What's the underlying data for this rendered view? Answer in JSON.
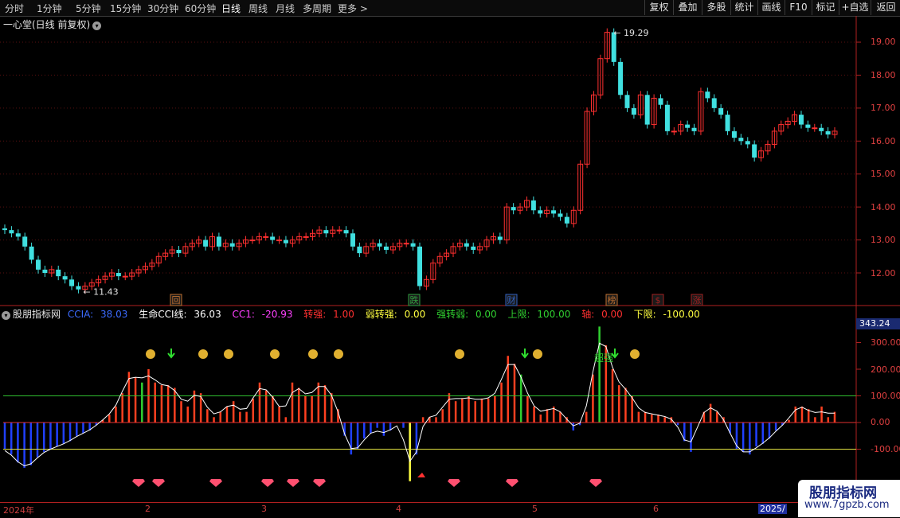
{
  "toolbar": {
    "timeframes": [
      "分时",
      "1分钟",
      "5分钟",
      "15分钟",
      "30分钟",
      "60分钟",
      "日线",
      "周线",
      "月线",
      "多周期",
      "更多 >"
    ],
    "active_timeframe": "日线",
    "buttons": [
      "复权",
      "叠加",
      "多股",
      "统计",
      "画线",
      "F10",
      "标记",
      "+自选",
      "返回"
    ]
  },
  "main_chart": {
    "title": "一心堂(日线 前复权)",
    "price_axis": [
      "19.00",
      "18.00",
      "17.00",
      "16.00",
      "15.00",
      "14.00",
      "13.00",
      "12.00"
    ],
    "high_label": "19.29",
    "low_label": "11.43",
    "event_markers": [
      "回",
      "跌",
      "财",
      "榜",
      "$",
      "涨"
    ]
  },
  "indicator": {
    "name": "股朋指标网",
    "fields": [
      {
        "label": "CCIA: ",
        "value": "38.03",
        "color": "#3b6bff"
      },
      {
        "label": "生命CCI线: ",
        "value": "36.03",
        "color": "#ffffff"
      },
      {
        "label": "CC1: ",
        "value": "-20.93",
        "color": "#ff40ff"
      },
      {
        "label": "转强: ",
        "value": "1.00",
        "color": "#ff3030"
      },
      {
        "label": "弱转强: ",
        "value": "0.00",
        "color": "#ffff40"
      },
      {
        "label": "强转弱: ",
        "value": "0.00",
        "color": "#30d030"
      },
      {
        "label": "上限: ",
        "value": "100.00",
        "color": "#30d030"
      },
      {
        "label": "轴: ",
        "value": "0.00",
        "color": "#ff3030"
      },
      {
        "label": "下限: ",
        "value": "-100.00",
        "color": "#ffff40"
      }
    ],
    "axis": [
      "300.00",
      "200.00",
      "100.00",
      "0.00",
      "-100.00"
    ],
    "current_value": "343.24",
    "chart_texts": [
      "超强"
    ]
  },
  "date_axis": {
    "year": "2024年",
    "months": [
      "2",
      "3",
      "4",
      "5",
      "6"
    ],
    "year_next": "2025/"
  },
  "watermark": {
    "title": "股朋指标网",
    "url": "www.7gpzb.com"
  },
  "chart_data": [
    {
      "type": "candlestick",
      "title": "一心堂(日线 前复权)",
      "y_axis": [
        11.6,
        19.6
      ],
      "close": [
        13.3,
        13.2,
        13.1,
        12.8,
        12.4,
        12.1,
        12.0,
        12.1,
        11.9,
        11.8,
        11.6,
        11.5,
        11.6,
        11.7,
        11.8,
        11.9,
        12.0,
        11.9,
        11.9,
        12.0,
        12.1,
        12.2,
        12.3,
        12.5,
        12.6,
        12.7,
        12.6,
        12.8,
        12.9,
        13.0,
        12.8,
        13.1,
        12.8,
        12.9,
        12.8,
        12.9,
        13.0,
        13.0,
        13.1,
        13.1,
        13.0,
        13.0,
        12.9,
        13.0,
        13.1,
        13.1,
        13.2,
        13.3,
        13.2,
        13.3,
        13.3,
        13.2,
        12.8,
        12.6,
        12.8,
        12.9,
        12.8,
        12.7,
        12.8,
        12.9,
        12.9,
        12.8,
        11.6,
        11.8,
        12.3,
        12.5,
        12.6,
        12.8,
        12.9,
        12.8,
        12.7,
        12.8,
        13.0,
        13.1,
        13.0,
        14.0,
        13.9,
        14.0,
        14.2,
        13.9,
        13.8,
        13.9,
        13.8,
        13.7,
        13.5,
        13.9,
        15.3,
        16.9,
        17.4,
        18.5,
        19.3,
        18.4,
        17.4,
        17.0,
        16.8,
        17.4,
        16.5,
        17.3,
        17.1,
        16.3,
        16.3,
        16.5,
        16.4,
        16.3,
        17.5,
        17.3,
        17.0,
        16.8,
        16.3,
        16.1,
        16.0,
        15.9,
        15.5,
        15.7,
        15.9,
        16.3,
        16.5,
        16.6,
        16.8,
        16.5,
        16.4,
        16.4,
        16.3,
        16.2,
        16.3
      ]
    },
    {
      "type": "bar",
      "title": "股朋指标网",
      "series_name": "CCIA",
      "y_axis": [
        -230,
        380
      ],
      "values": [
        -100,
        -120,
        -150,
        -170,
        -160,
        -130,
        -110,
        -100,
        -90,
        -80,
        -70,
        -50,
        -40,
        -30,
        -10,
        10,
        30,
        60,
        110,
        190,
        170,
        150,
        200,
        150,
        140,
        140,
        130,
        80,
        60,
        120,
        110,
        50,
        20,
        40,
        60,
        80,
        40,
        40,
        90,
        150,
        120,
        100,
        60,
        20,
        150,
        130,
        100,
        100,
        150,
        140,
        110,
        50,
        -50,
        -120,
        -100,
        -60,
        -40,
        -20,
        -50,
        -30,
        0,
        -20,
        -220,
        -120,
        20,
        20,
        20,
        50,
        110,
        80,
        90,
        100,
        80,
        90,
        90,
        100,
        150,
        250,
        220,
        180,
        100,
        60,
        30,
        50,
        60,
        40,
        20,
        -30,
        -10,
        40,
        180,
        360,
        290,
        200,
        140,
        130,
        100,
        40,
        40,
        30,
        30,
        20,
        20,
        -10,
        -70,
        -110,
        0,
        40,
        70,
        40,
        20,
        -40,
        -100,
        -110,
        -120,
        -90,
        -80,
        -60,
        -30,
        -10,
        10,
        60,
        60,
        50,
        20,
        60,
        20,
        40
      ]
    }
  ]
}
